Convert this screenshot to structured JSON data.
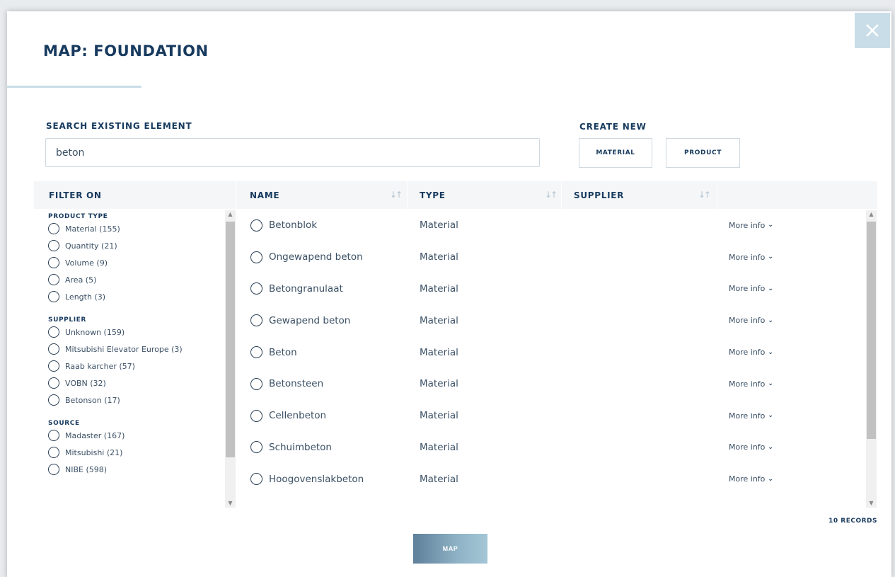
{
  "dialog": {
    "title": "MAP: FOUNDATION",
    "close_icon": "close-icon"
  },
  "search": {
    "label": "SEARCH EXISTING ELEMENT",
    "value": "beton"
  },
  "create_new": {
    "label": "CREATE NEW",
    "material_label": "MATERIAL",
    "product_label": "PRODUCT"
  },
  "table": {
    "filter_header": "FILTER ON",
    "name_header": "NAME",
    "type_header": "TYPE",
    "supplier_header": "SUPPLIER"
  },
  "filters": {
    "product_type": {
      "title": "PRODUCT TYPE",
      "items": [
        "Material (155)",
        "Quantity (21)",
        "Volume (9)",
        "Area (5)",
        "Length (3)"
      ]
    },
    "supplier": {
      "title": "SUPPLIER",
      "items": [
        "Unknown (159)",
        "Mitsubishi Elevator Europe (3)",
        "Raab karcher (57)",
        "VOBN (32)",
        "Betonson (17)"
      ]
    },
    "source": {
      "title": "SOURCE",
      "items": [
        "Madaster (167)",
        "Mitsubishi (21)",
        "NIBE (598)"
      ]
    }
  },
  "results": [
    {
      "name": "Betonblok",
      "type": "Material",
      "supplier": "",
      "more": "More info"
    },
    {
      "name": "Ongewapend beton",
      "type": "Material",
      "supplier": "",
      "more": "More info"
    },
    {
      "name": "Betongranulaat",
      "type": "Material",
      "supplier": "",
      "more": "More info"
    },
    {
      "name": "Gewapend beton",
      "type": "Material",
      "supplier": "",
      "more": "More info"
    },
    {
      "name": "Beton",
      "type": "Material",
      "supplier": "",
      "more": "More info"
    },
    {
      "name": "Betonsteen",
      "type": "Material",
      "supplier": "",
      "more": "More info"
    },
    {
      "name": "Cellenbeton",
      "type": "Material",
      "supplier": "",
      "more": "More info"
    },
    {
      "name": "Schuimbeton",
      "type": "Material",
      "supplier": "",
      "more": "More info"
    },
    {
      "name": "Hoogovenslakbeton",
      "type": "Material",
      "supplier": "",
      "more": "More info"
    }
  ],
  "records": "10 RECORDS",
  "map_button": "MAP",
  "colors": {
    "primary": "#173a5e",
    "accent_light": "#c9dde8",
    "map_gradient_start": "#5f7f9a",
    "map_gradient_end": "#a4c6d6"
  }
}
